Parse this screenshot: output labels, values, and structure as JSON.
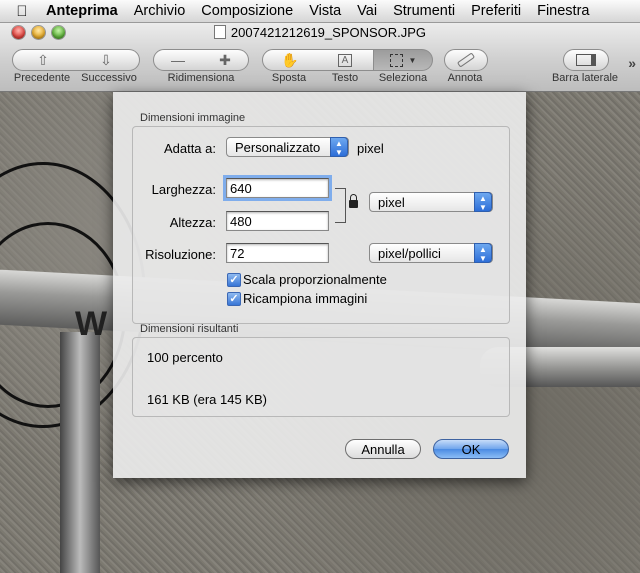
{
  "menubar": {
    "apple": "",
    "items": [
      "Anteprima",
      "Archivio",
      "Composizione",
      "Vista",
      "Vai",
      "Strumenti",
      "Preferiti",
      "Finestra"
    ]
  },
  "window": {
    "title": "2007421212619_SPONSOR.JPG"
  },
  "toolbar": {
    "precedente": "Precedente",
    "successivo": "Successivo",
    "ridimensiona": "Ridimensiona",
    "sposta": "Sposta",
    "testo": "Testo",
    "seleziona": "Seleziona",
    "annota": "Annota",
    "barra_laterale": "Barra laterale",
    "overflow": "»"
  },
  "photo": {
    "brand_text": "W"
  },
  "dialog": {
    "section1_title": "Dimensioni immagine",
    "fit_label": "Adatta a:",
    "fit_value": "Personalizzato",
    "fit_unit": "pixel",
    "width_label": "Larghezza:",
    "width_value": "640",
    "height_label": "Altezza:",
    "height_value": "480",
    "size_unit": "pixel",
    "resolution_label": "Risoluzione:",
    "resolution_value": "72",
    "resolution_unit": "pixel/pollici",
    "scale_label": "Scala proporzionalmente",
    "scale_checked": true,
    "resample_label": "Ricampiona immagini",
    "resample_checked": true,
    "section2_title": "Dimensioni risultanti",
    "percent_text": "100 percento",
    "size_text": "161 KB (era 145 KB)",
    "cancel_label": "Annulla",
    "ok_label": "OK"
  }
}
